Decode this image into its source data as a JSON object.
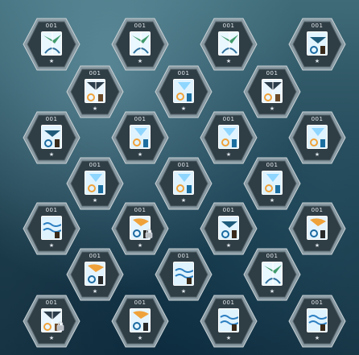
{
  "cards": [
    {
      "row": 0,
      "col": 0,
      "number": "001",
      "star": "★",
      "art": "green-bird",
      "locked": false
    },
    {
      "row": 0,
      "col": 1,
      "number": "001",
      "star": "★",
      "art": "green-bird",
      "locked": false
    },
    {
      "row": 0,
      "col": 2,
      "number": "001",
      "star": "★",
      "art": "green-bird",
      "locked": false
    },
    {
      "row": 0,
      "col": 3,
      "number": "001",
      "star": "★",
      "art": "swirl-gate",
      "locked": false
    },
    {
      "row": 1,
      "col": 0,
      "number": "001",
      "star": "★",
      "art": "feather-swirl",
      "locked": false
    },
    {
      "row": 1,
      "col": 1,
      "number": "001",
      "star": "★",
      "art": "ice-crystal",
      "locked": false
    },
    {
      "row": 1,
      "col": 2,
      "number": "001",
      "star": "★",
      "art": "feather-swirl",
      "locked": false
    },
    {
      "row": 2,
      "col": 0,
      "number": "001",
      "star": "★",
      "art": "swirl-gate",
      "locked": false
    },
    {
      "row": 2,
      "col": 1,
      "number": "001",
      "star": "★",
      "art": "ice-crystal",
      "locked": false
    },
    {
      "row": 2,
      "col": 2,
      "number": "001",
      "star": "★",
      "art": "ice-crystal",
      "locked": false
    },
    {
      "row": 2,
      "col": 3,
      "number": "001",
      "star": "★",
      "art": "ice-crystal",
      "locked": false
    },
    {
      "row": 3,
      "col": 0,
      "number": "001",
      "star": "★",
      "art": "ice-crystal",
      "locked": false
    },
    {
      "row": 3,
      "col": 1,
      "number": "001",
      "star": "★",
      "art": "ice-crystal",
      "locked": false
    },
    {
      "row": 3,
      "col": 2,
      "number": "001",
      "star": "★",
      "art": "ice-crystal",
      "locked": false
    },
    {
      "row": 4,
      "col": 0,
      "number": "001",
      "star": "★",
      "art": "waves",
      "locked": false
    },
    {
      "row": 4,
      "col": 1,
      "number": "001",
      "star": "★",
      "art": "orange-swirl",
      "locked": true
    },
    {
      "row": 4,
      "col": 2,
      "number": "001",
      "star": "★",
      "art": "swirl-gate",
      "locked": false
    },
    {
      "row": 4,
      "col": 3,
      "number": "001",
      "star": "★",
      "art": "orange-swirl",
      "locked": false
    },
    {
      "row": 5,
      "col": 0,
      "number": "001",
      "star": "★",
      "art": "orange-swirl",
      "locked": false
    },
    {
      "row": 5,
      "col": 1,
      "number": "001",
      "star": "★",
      "art": "waves",
      "locked": false
    },
    {
      "row": 5,
      "col": 2,
      "number": "001",
      "star": "★",
      "art": "green-bird",
      "locked": false
    },
    {
      "row": 6,
      "col": 0,
      "number": "001",
      "star": "★",
      "art": "feather-swirl",
      "locked": true
    },
    {
      "row": 6,
      "col": 1,
      "number": "001",
      "star": "★",
      "art": "orange-swirl",
      "locked": false
    },
    {
      "row": 6,
      "col": 2,
      "number": "001",
      "star": "★",
      "art": "waves",
      "locked": false
    },
    {
      "row": 6,
      "col": 3,
      "number": "001",
      "star": "★",
      "art": "waves",
      "locked": false
    }
  ],
  "colors": {
    "hex_outer": "#8a9aa3",
    "hex_inner": "#2f3d45",
    "card_border": "#ffffff",
    "sky": "#bfe6ff",
    "accent_orange": "#f0a23a",
    "accent_green": "#3f9a6a"
  },
  "icons": {
    "lock": "lock-icon",
    "star": "star-icon"
  }
}
